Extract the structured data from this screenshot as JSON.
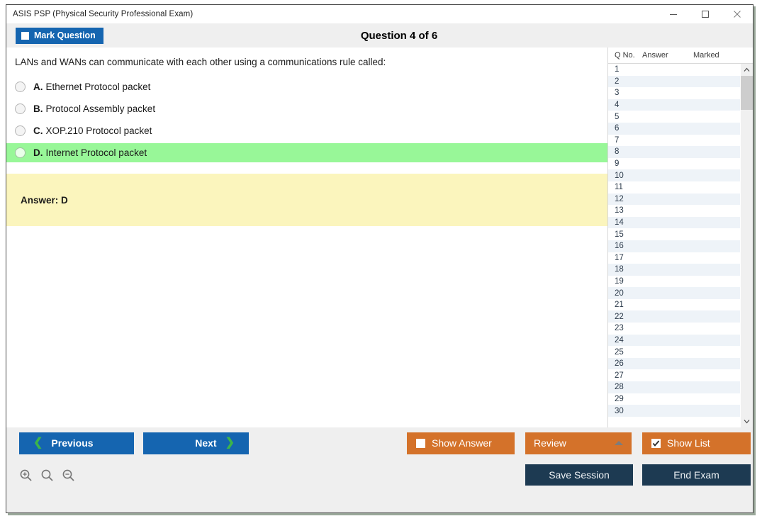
{
  "window": {
    "title": "ASIS PSP (Physical Security Professional Exam)",
    "minimize_label": "Minimize",
    "maximize_label": "Maximize",
    "close_label": "Close"
  },
  "header": {
    "mark_button_label": "Mark Question",
    "mark_checked": false,
    "question_title": "Question 4 of 6"
  },
  "question": {
    "text": "LANs and WANs can communicate with each other using a communications rule called:",
    "options": [
      {
        "letter": "A.",
        "text": "Ethernet Protocol packet",
        "selected": false,
        "correct": false
      },
      {
        "letter": "B.",
        "text": "Protocol Assembly packet",
        "selected": false,
        "correct": false
      },
      {
        "letter": "C.",
        "text": "XOP.210 Protocol packet",
        "selected": false,
        "correct": false
      },
      {
        "letter": "D.",
        "text": "Internet Protocol packet",
        "selected": false,
        "correct": true
      }
    ],
    "answer_label": "Answer: D"
  },
  "question_list": {
    "columns": [
      "Q No.",
      "Answer",
      "Marked"
    ],
    "rows": [
      {
        "no": "1",
        "answer": "",
        "marked": ""
      },
      {
        "no": "2",
        "answer": "",
        "marked": ""
      },
      {
        "no": "3",
        "answer": "",
        "marked": ""
      },
      {
        "no": "4",
        "answer": "",
        "marked": ""
      },
      {
        "no": "5",
        "answer": "",
        "marked": ""
      },
      {
        "no": "6",
        "answer": "",
        "marked": ""
      },
      {
        "no": "7",
        "answer": "",
        "marked": ""
      },
      {
        "no": "8",
        "answer": "",
        "marked": ""
      },
      {
        "no": "9",
        "answer": "",
        "marked": ""
      },
      {
        "no": "10",
        "answer": "",
        "marked": ""
      },
      {
        "no": "11",
        "answer": "",
        "marked": ""
      },
      {
        "no": "12",
        "answer": "",
        "marked": ""
      },
      {
        "no": "13",
        "answer": "",
        "marked": ""
      },
      {
        "no": "14",
        "answer": "",
        "marked": ""
      },
      {
        "no": "15",
        "answer": "",
        "marked": ""
      },
      {
        "no": "16",
        "answer": "",
        "marked": ""
      },
      {
        "no": "17",
        "answer": "",
        "marked": ""
      },
      {
        "no": "18",
        "answer": "",
        "marked": ""
      },
      {
        "no": "19",
        "answer": "",
        "marked": ""
      },
      {
        "no": "20",
        "answer": "",
        "marked": ""
      },
      {
        "no": "21",
        "answer": "",
        "marked": ""
      },
      {
        "no": "22",
        "answer": "",
        "marked": ""
      },
      {
        "no": "23",
        "answer": "",
        "marked": ""
      },
      {
        "no": "24",
        "answer": "",
        "marked": ""
      },
      {
        "no": "25",
        "answer": "",
        "marked": ""
      },
      {
        "no": "26",
        "answer": "",
        "marked": ""
      },
      {
        "no": "27",
        "answer": "",
        "marked": ""
      },
      {
        "no": "28",
        "answer": "",
        "marked": ""
      },
      {
        "no": "29",
        "answer": "",
        "marked": ""
      },
      {
        "no": "30",
        "answer": "",
        "marked": ""
      }
    ]
  },
  "footer": {
    "previous_label": "Previous",
    "next_label": "Next",
    "show_answer_label": "Show Answer",
    "show_answer_checked": false,
    "review_label": "Review",
    "show_list_label": "Show List",
    "show_list_checked": true,
    "save_session_label": "Save Session",
    "end_exam_label": "End Exam",
    "zoom_in_name": "zoom-in-icon",
    "zoom_reset_name": "zoom-reset-icon",
    "zoom_out_name": "zoom-out-icon"
  },
  "colors": {
    "accent_blue": "#1565b0",
    "accent_orange": "#d4722a",
    "accent_navy": "#1d3a52",
    "correct_green": "#98f798",
    "answer_yellow": "#fbf5bd",
    "chevron_green": "#3cb54a"
  }
}
